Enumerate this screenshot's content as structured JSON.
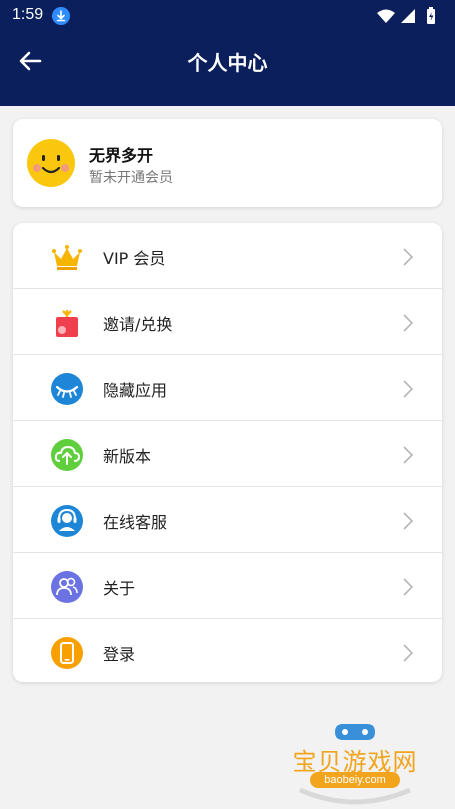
{
  "status_bar": {
    "time": "1:59"
  },
  "header": {
    "title": "个人中心"
  },
  "profile": {
    "name": "无界多开",
    "membership_status": "暂未开通会员"
  },
  "menu": {
    "items": [
      {
        "label": "VIP 会员",
        "icon": "crown-icon"
      },
      {
        "label": "邀请/兑换",
        "icon": "gift-box-icon"
      },
      {
        "label": "隐藏应用",
        "icon": "closed-eye-icon"
      },
      {
        "label": "新版本",
        "icon": "cloud-upload-icon"
      },
      {
        "label": "在线客服",
        "icon": "customer-service-icon"
      },
      {
        "label": "关于",
        "icon": "users-icon"
      },
      {
        "label": "登录",
        "icon": "phone-icon"
      }
    ]
  },
  "watermark": {
    "text": "宝贝游戏网",
    "url": "baobeiy.com"
  },
  "colors": {
    "header_bg": "#0a1f5c",
    "page_bg": "#f2f2f2",
    "card_bg": "#ffffff"
  }
}
